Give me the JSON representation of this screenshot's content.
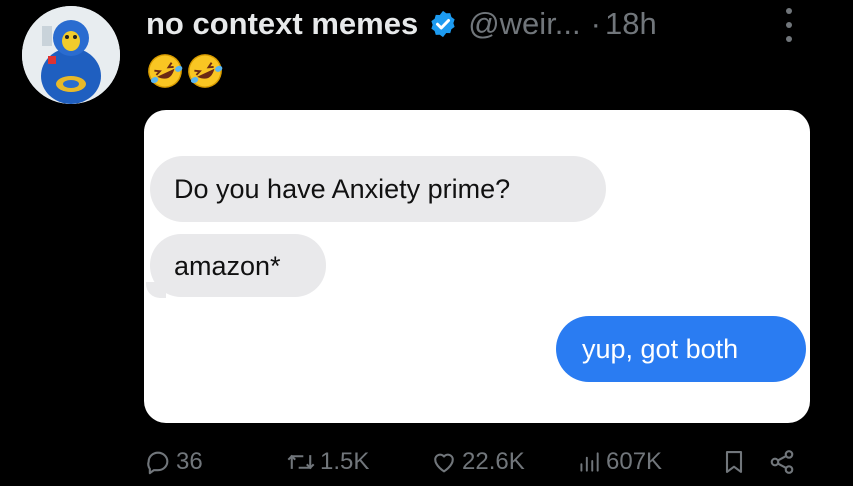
{
  "post": {
    "author_name": "no context memes",
    "handle": "@weir...",
    "separator": "·",
    "time": "18h",
    "text_emojis": [
      "rolling-on-floor-laughing",
      "rolling-on-floor-laughing"
    ]
  },
  "media": {
    "messages": [
      {
        "text": "Do you have Anxiety prime?",
        "side": "left"
      },
      {
        "text": "amazon*",
        "side": "left"
      },
      {
        "text": "yup, got both",
        "side": "right"
      }
    ],
    "colors": {
      "received": "#e9e9eb",
      "sent": "#2a7cf2"
    }
  },
  "actions": {
    "replies": "36",
    "reposts": "1.5K",
    "likes": "22.6K",
    "views": "607K"
  },
  "icons": [
    "verified-badge-icon",
    "more-options-icon",
    "reply-icon",
    "repost-icon",
    "like-icon",
    "views-icon",
    "bookmark-icon",
    "share-icon"
  ]
}
